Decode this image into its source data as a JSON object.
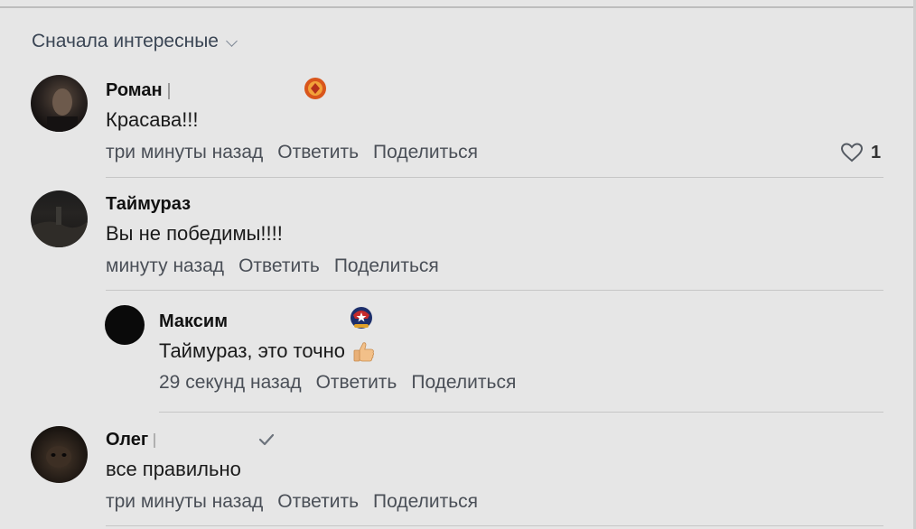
{
  "sort": {
    "label": "Сначала интересные"
  },
  "comments": [
    {
      "author": "Роман",
      "text": "Красава!!!",
      "time": "три минуты назад",
      "reply": "Ответить",
      "share": "Поделиться",
      "likes": "1"
    },
    {
      "author": "Таймураз",
      "text": "Вы не победимы!!!!",
      "time": "минуту назад",
      "reply": "Ответить",
      "share": "Поделиться"
    },
    {
      "author": "Максим",
      "text": "Таймураз, это точно",
      "time": "29 секунд назад",
      "reply": "Ответить",
      "share": "Поделиться"
    },
    {
      "author": "Олег",
      "text": "все правильно",
      "time": "три минуты назад",
      "reply": "Ответить",
      "share": "Поделиться"
    }
  ],
  "icons": {
    "sort": "chevron-down-icon",
    "like": "heart-icon",
    "verified": "checkmark-icon",
    "thumb": "thumbs-up-emoji-icon"
  }
}
